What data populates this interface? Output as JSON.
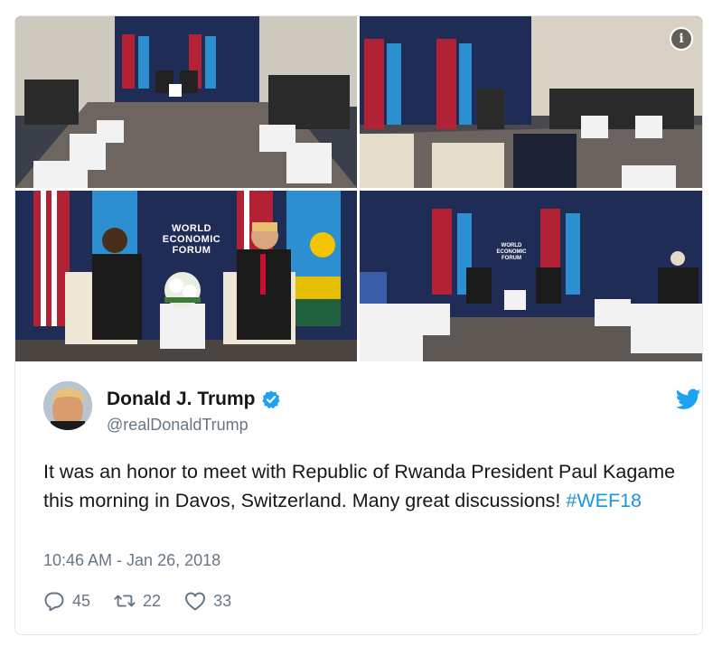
{
  "tweet": {
    "display_name": "Donald J. Trump",
    "handle": "@realDonaldTrump",
    "text_main": "It was an honor to meet with Republic of Rwanda President Paul Kagame this morning in Davos, Switzerland. Many great discussions!",
    "hashtag": "#WEF18",
    "timestamp": "10:46 AM - Jan 26, 2018",
    "verified": true
  },
  "media": {
    "info_icon_label": "i",
    "backdrop_text_lines": [
      "WORLD",
      "ECONOMIC",
      "FORUM"
    ]
  },
  "actions": {
    "replies": "45",
    "retweets": "22",
    "likes": "33"
  },
  "colors": {
    "link": "#1b95e0",
    "secondary_text": "#657786",
    "verified": "#1da1f2",
    "border": "#e1e8ed",
    "backdrop": "#1f2d56"
  },
  "icons": {
    "verified": "verified-badge-icon",
    "bird": "twitter-bird-icon",
    "reply": "reply-icon",
    "retweet": "retweet-icon",
    "like": "heart-icon",
    "info": "info-icon"
  }
}
